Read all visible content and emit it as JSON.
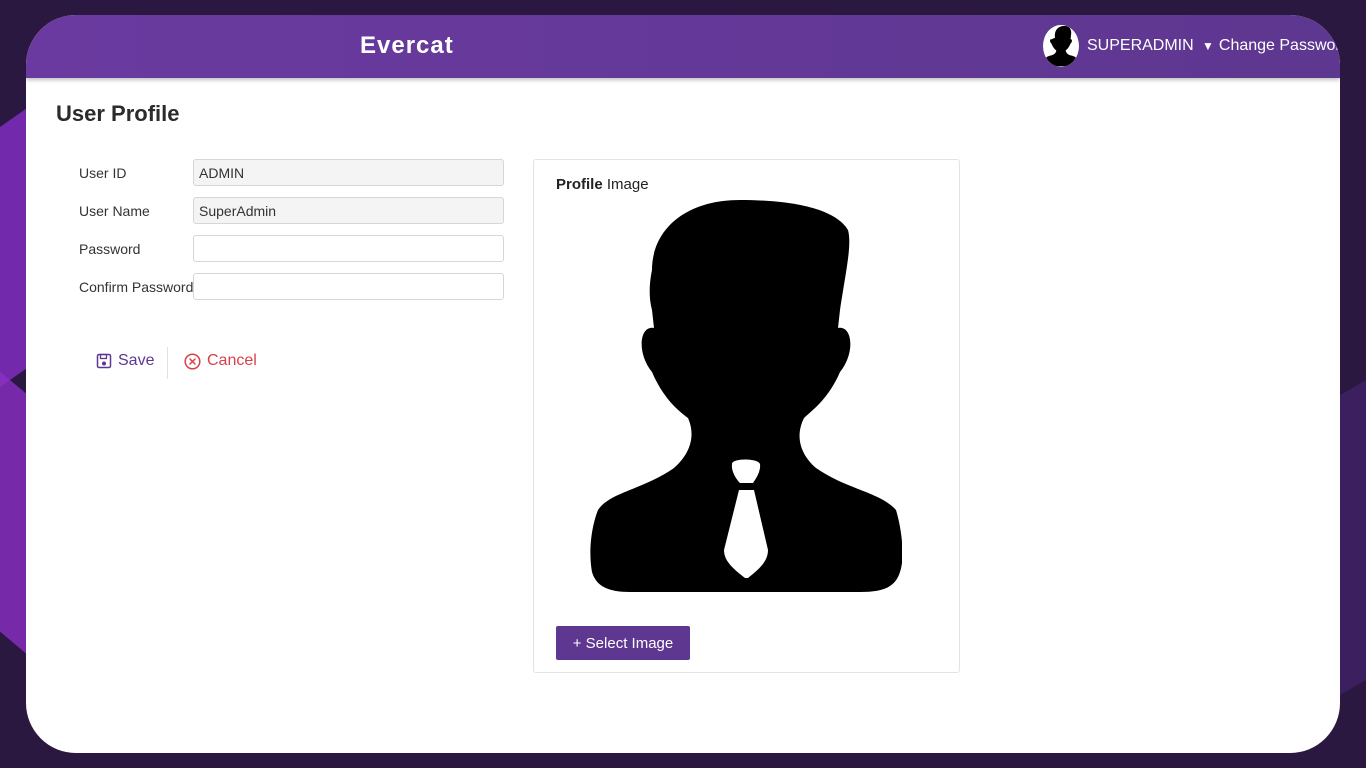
{
  "app": {
    "brand": "Evercat",
    "user_name": "SUPERADMIN",
    "menu_caret": "▼",
    "change_password": "Change Password"
  },
  "page": {
    "title": "User Profile"
  },
  "form": {
    "user_id": {
      "label": "User ID",
      "value": "ADMIN"
    },
    "user_name": {
      "label": "User Name",
      "value": "SuperAdmin"
    },
    "password": {
      "label": "Password",
      "value": ""
    },
    "confirm_password": {
      "label": "Confirm Password",
      "value": ""
    }
  },
  "actions": {
    "save_label": "Save",
    "cancel_label": "Cancel"
  },
  "profile_image": {
    "title_bold": "Profile",
    "title_rest": " Image",
    "select_button": "+ Select Image"
  },
  "colors": {
    "topbar": "#5e3790",
    "accent": "#5e3790",
    "cancel": "#d9404a"
  },
  "icons": {
    "save": "floppy-disk-icon",
    "cancel": "circle-x-icon",
    "avatar": "user-silhouette-icon",
    "caret": "caret-down-icon"
  }
}
